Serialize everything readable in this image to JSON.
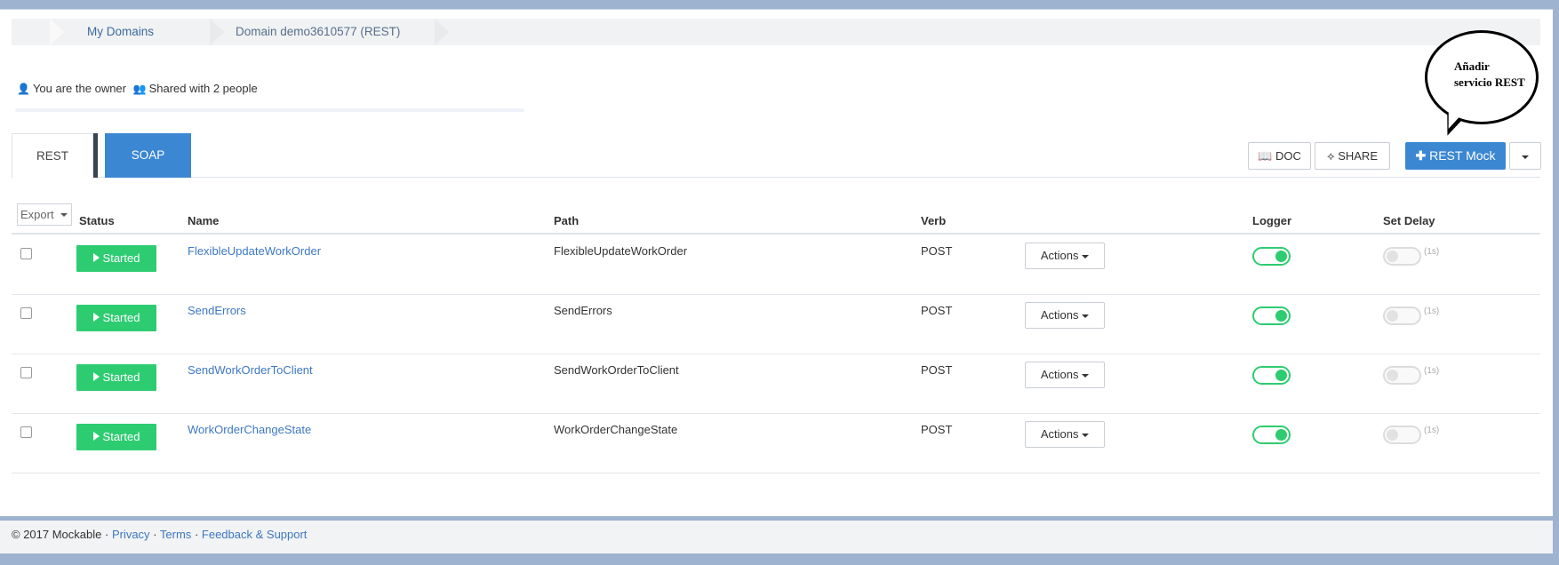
{
  "breadcrumb": {
    "items": [
      "My Domains",
      "Domain demo3610577 (REST)"
    ]
  },
  "ownership": {
    "owner_text": "You are the owner",
    "shared_text": "Shared with 2 people"
  },
  "progress": {
    "value": 0
  },
  "tabs": [
    "REST",
    "SOAP"
  ],
  "toolbar": {
    "doc_label": "DOC",
    "share_label": "SHARE",
    "rest_mock_label": "REST Mock"
  },
  "callout": {
    "text": "Añadir servicio REST"
  },
  "table": {
    "export_label": "Export",
    "columns": [
      "Status",
      "Name",
      "Path",
      "Verb",
      "Logger",
      "Set Delay"
    ],
    "rows": [
      {
        "status": "Started",
        "name": "FlexibleUpdateWorkOrder",
        "path": "FlexibleUpdateWorkOrder",
        "verb": "POST",
        "actions": "Actions",
        "logger": true,
        "delay_enabled": false,
        "delay_label": "(1s)"
      },
      {
        "status": "Started",
        "name": "SendErrors",
        "path": "SendErrors",
        "verb": "POST",
        "actions": "Actions",
        "logger": true,
        "delay_enabled": false,
        "delay_label": "(1s)"
      },
      {
        "status": "Started",
        "name": "SendWorkOrderToClient",
        "path": "SendWorkOrderToClient",
        "verb": "POST",
        "actions": "Actions",
        "logger": true,
        "delay_enabled": false,
        "delay_label": "(1s)"
      },
      {
        "status": "Started",
        "name": "WorkOrderChangeState",
        "path": "WorkOrderChangeState",
        "verb": "POST",
        "actions": "Actions",
        "logger": true,
        "delay_enabled": false,
        "delay_label": "(1s)"
      }
    ]
  },
  "footer": {
    "copyright": "© 2017 Mockable ·",
    "privacy": "Privacy",
    "terms": "Terms",
    "feedback": "Feedback & Support",
    "sep": "·"
  },
  "colors": {
    "primary": "#3b87d2",
    "success": "#2ecc71",
    "frame": "#9db3cf",
    "link": "#3d78c2"
  },
  "icons": {
    "owner": "user-icon",
    "shared": "group-icon",
    "doc": "book-icon",
    "share": "share-icon",
    "add": "plus-icon",
    "play": "play-icon"
  }
}
